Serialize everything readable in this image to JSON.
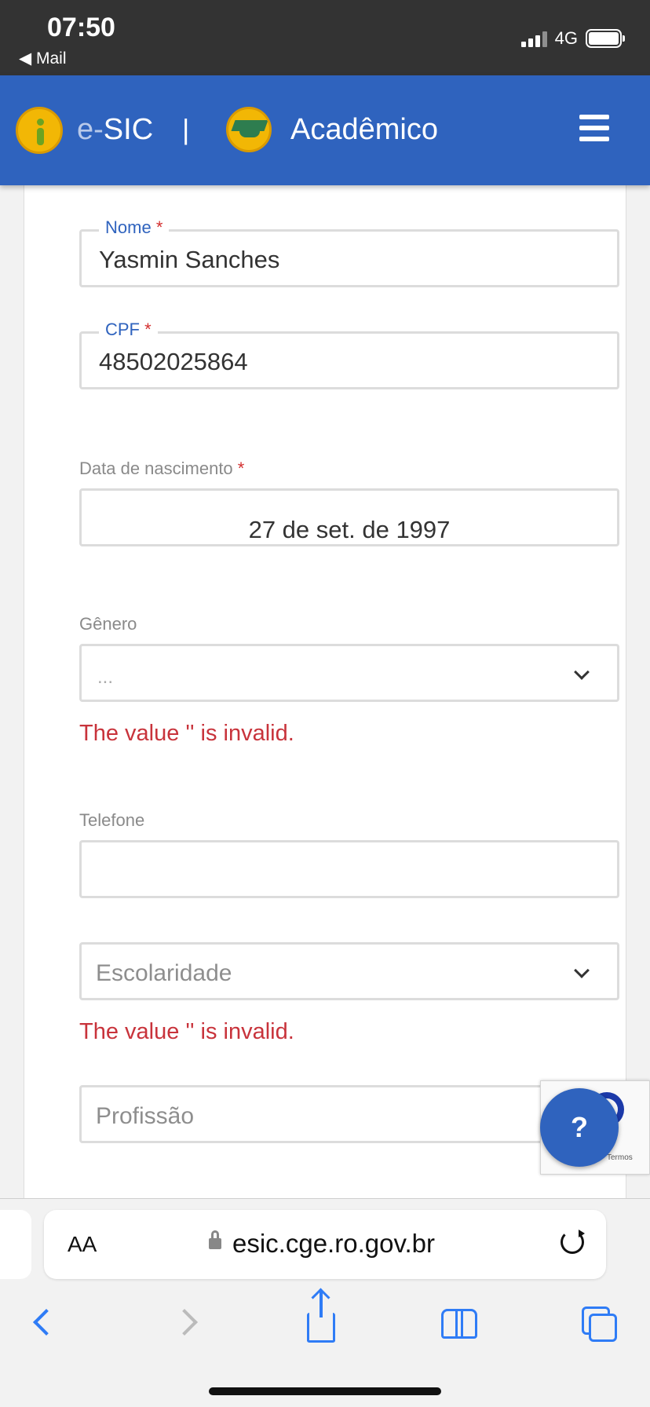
{
  "status_bar": {
    "time": "07:50",
    "back_app": "◀ Mail",
    "network": "4G"
  },
  "header": {
    "brand_prefix": "e-",
    "brand_name": "SIC",
    "separator": "|",
    "title": "Acadêmico",
    "bg_color": "#2f63be"
  },
  "form": {
    "nome": {
      "label": "Nome",
      "required_mark": "*",
      "value": "Yasmin Sanches"
    },
    "cpf": {
      "label": "CPF",
      "required_mark": "*",
      "value": "48502025864"
    },
    "nascimento": {
      "label": "Data de nascimento",
      "required_mark": "*",
      "value": "27 de set. de 1997"
    },
    "genero": {
      "label": "Gênero",
      "value": "...",
      "error": "The value '' is invalid."
    },
    "telefone": {
      "label": "Telefone",
      "value": ""
    },
    "escolaridade": {
      "placeholder": "Escolaridade",
      "error": "The value '' is invalid."
    },
    "profissao": {
      "placeholder": "Profissão"
    }
  },
  "recaptcha": {
    "terms": "Termos"
  },
  "help_button": {
    "label": "?"
  },
  "browser": {
    "aa_label": "AA",
    "url": "esic.cge.ro.gov.br"
  },
  "colors": {
    "accent": "#2f63be",
    "error": "#c8333b",
    "ios_blue": "#2f7cf6"
  }
}
